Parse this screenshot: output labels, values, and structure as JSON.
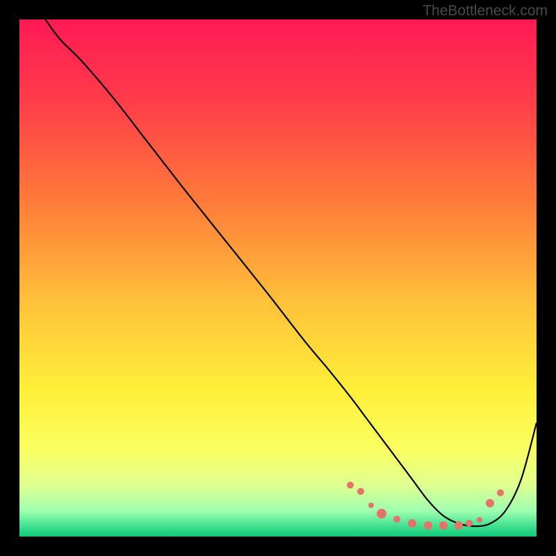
{
  "watermark": "TheBottleneck.com",
  "chart_data": {
    "type": "line",
    "title": "",
    "xlabel": "",
    "ylabel": "",
    "xlim": [
      0,
      100
    ],
    "ylim": [
      0,
      100
    ],
    "series": [
      {
        "name": "curve",
        "x": [
          5,
          8,
          12,
          18,
          25,
          32,
          40,
          48,
          55,
          60,
          64,
          67,
          70,
          73,
          76,
          79,
          82,
          85,
          88,
          91,
          94,
          97,
          100
        ],
        "y": [
          100,
          96,
          92,
          85,
          76,
          67,
          57,
          47,
          38,
          32,
          27,
          23,
          19,
          15,
          11,
          7,
          4,
          2.5,
          2,
          2.5,
          5,
          11,
          22
        ]
      }
    ],
    "markers": [
      {
        "x": 64,
        "y": 10,
        "size": 10
      },
      {
        "x": 66,
        "y": 8.7,
        "size": 10
      },
      {
        "x": 68,
        "y": 6,
        "size": 8
      },
      {
        "x": 70,
        "y": 4.5,
        "size": 14
      },
      {
        "x": 73,
        "y": 3.4,
        "size": 10
      },
      {
        "x": 76,
        "y": 2.6,
        "size": 12
      },
      {
        "x": 79,
        "y": 2.2,
        "size": 12
      },
      {
        "x": 82,
        "y": 2.1,
        "size": 12
      },
      {
        "x": 85,
        "y": 2.2,
        "size": 12
      },
      {
        "x": 87,
        "y": 2.6,
        "size": 10
      },
      {
        "x": 89,
        "y": 3.2,
        "size": 8
      },
      {
        "x": 91,
        "y": 6.5,
        "size": 12
      },
      {
        "x": 93,
        "y": 8.5,
        "size": 10
      }
    ],
    "gradient_stops": [
      {
        "offset": 0,
        "color": "#ff1a55"
      },
      {
        "offset": 0.15,
        "color": "#ff3a4a"
      },
      {
        "offset": 0.35,
        "color": "#ff7a3a"
      },
      {
        "offset": 0.55,
        "color": "#ffc23a"
      },
      {
        "offset": 0.72,
        "color": "#fff03a"
      },
      {
        "offset": 0.83,
        "color": "#faff60"
      },
      {
        "offset": 0.9,
        "color": "#e0ff90"
      },
      {
        "offset": 0.95,
        "color": "#a0ffb0"
      },
      {
        "offset": 0.98,
        "color": "#40e090"
      },
      {
        "offset": 1.0,
        "color": "#10c878"
      }
    ]
  }
}
